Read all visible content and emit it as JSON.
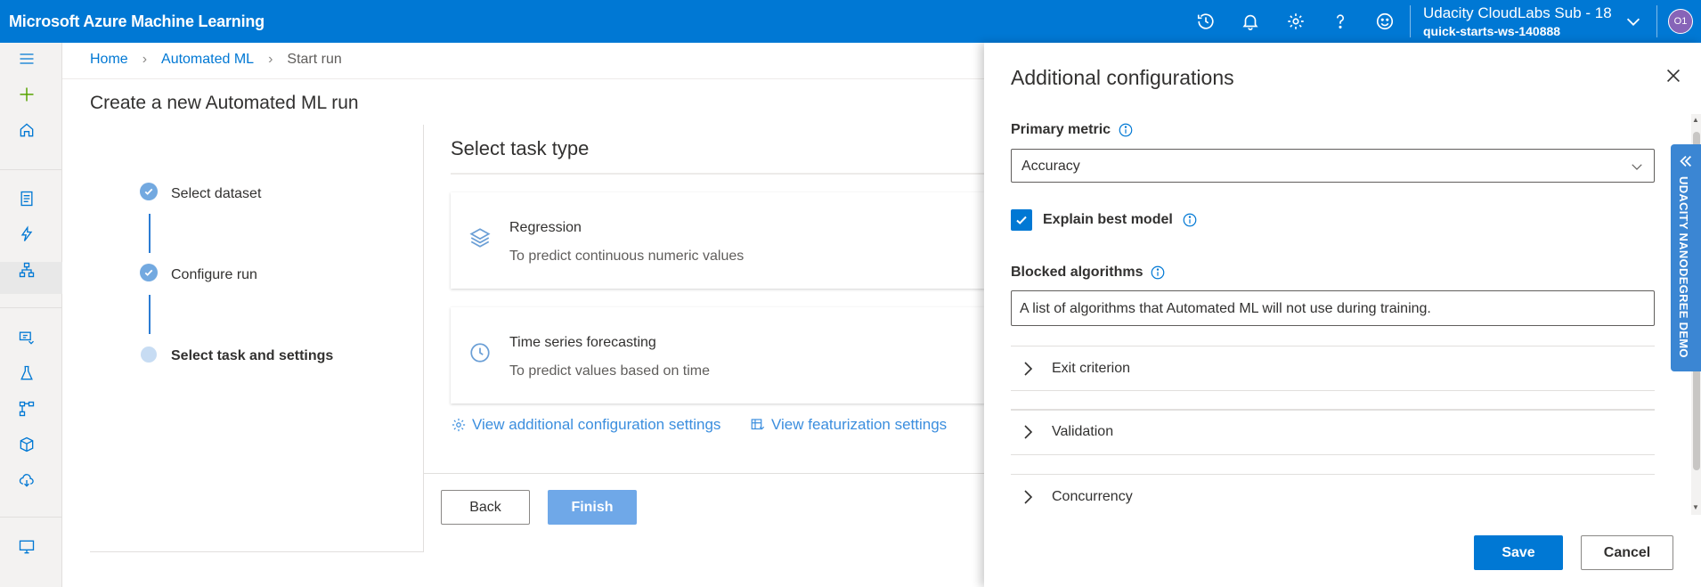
{
  "header": {
    "app_title": "Microsoft Azure Machine Learning",
    "subscription": "Udacity CloudLabs Sub - 18",
    "workspace": "quick-starts-ws-140888",
    "avatar_initials": "O1",
    "icons": [
      "history-icon",
      "bell-icon",
      "gear-icon",
      "help-icon",
      "smiley-icon",
      "chevron-down-icon"
    ]
  },
  "breadcrumb": {
    "home": "Home",
    "automl": "Automated ML",
    "current": "Start run"
  },
  "page": {
    "title": "Create a new Automated ML run"
  },
  "wizard": {
    "steps": [
      {
        "label": "Select dataset",
        "status": "complete"
      },
      {
        "label": "Configure run",
        "status": "complete"
      },
      {
        "label": "Select task and settings",
        "status": "current"
      }
    ]
  },
  "task": {
    "title": "Select task type",
    "cards": [
      {
        "name": "Regression",
        "description": "To predict continuous numeric values",
        "icon": "layers-icon"
      },
      {
        "name": "Time series forecasting",
        "description": "To predict values based on time",
        "icon": "clock-icon"
      }
    ],
    "link_additional": "View additional configuration settings",
    "link_featurization": "View featurization settings",
    "back_label": "Back",
    "finish_label": "Finish"
  },
  "panel": {
    "title": "Additional configurations",
    "primary_metric_label": "Primary metric",
    "primary_metric_value": "Accuracy",
    "explain_best_model_label": "Explain best model",
    "explain_best_model_checked": true,
    "blocked_algorithms_label": "Blocked algorithms",
    "blocked_algorithms_value": "A list of algorithms that Automated ML will not use during training.",
    "sections": [
      "Exit criterion",
      "Validation",
      "Concurrency"
    ],
    "save_label": "Save",
    "cancel_label": "Cancel"
  },
  "side_tab": {
    "label": "UDACITY NANODEGREE DEMO"
  },
  "colors": {
    "brand": "#0078d4",
    "finish_disabled": "#6fa8e8",
    "side_tab": "#3b86d3"
  }
}
